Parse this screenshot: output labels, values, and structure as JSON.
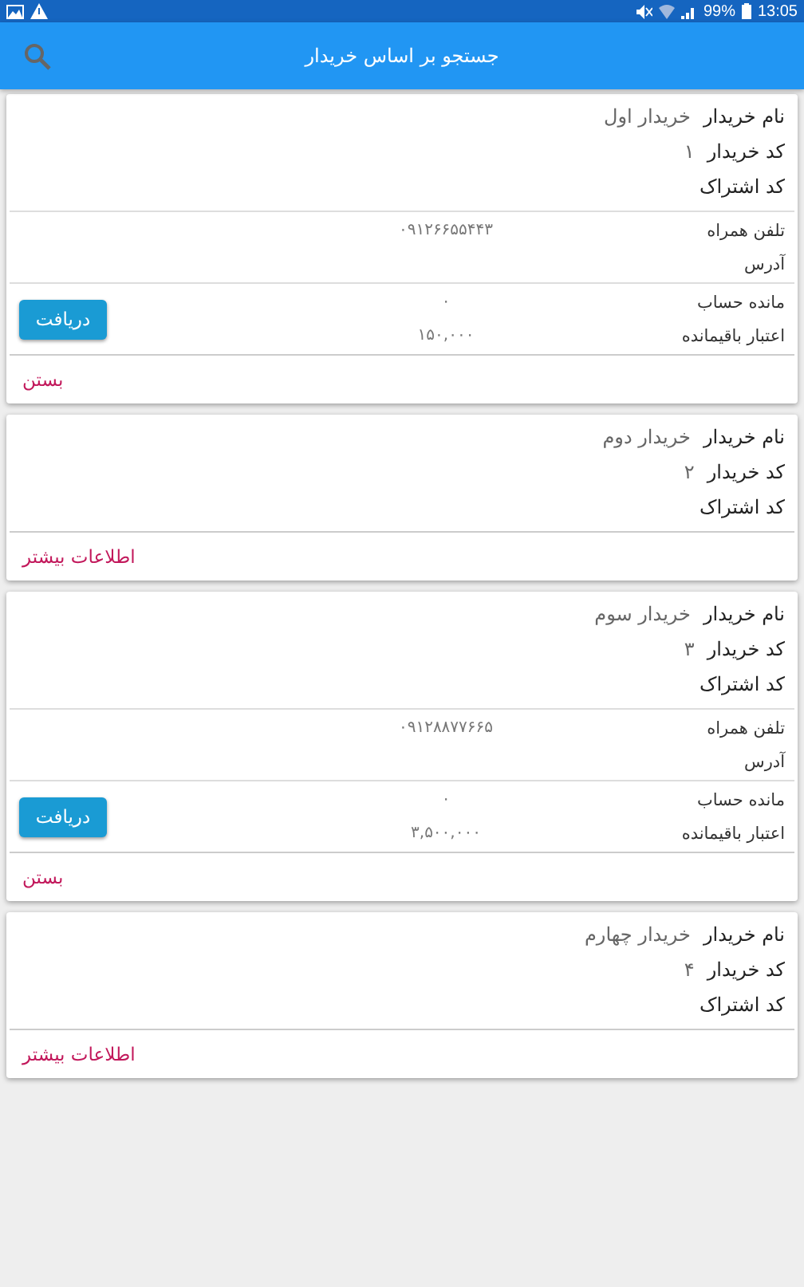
{
  "status_bar": {
    "battery": "99%",
    "time": "13:05"
  },
  "app_bar": {
    "title": "جستجو بر اساس خریدار"
  },
  "cards": [
    {
      "name_label": "نام خریدار",
      "name": "خریدار اول",
      "code_label": "کد خریدار",
      "code": "۱",
      "subscription_label": "کد اشتراک",
      "expanded": true,
      "phone_label": "تلفن همراه",
      "phone": "۰۹۱۲۶۶۵۵۴۴۳",
      "address_label": "آدرس",
      "balance_label": "مانده حساب",
      "balance": "۰",
      "credit_label": "اعتبار باقیمانده",
      "credit": "۱۵۰,۰۰۰",
      "button": "دریافت",
      "footer_link": "بستن"
    },
    {
      "name_label": "نام خریدار",
      "name": "خریدار دوم",
      "code_label": "کد خریدار",
      "code": "۲",
      "subscription_label": "کد اشتراک",
      "expanded": false,
      "footer_link": "اطلاعات بیشتر"
    },
    {
      "name_label": "نام خریدار",
      "name": "خریدار سوم",
      "code_label": "کد خریدار",
      "code": "۳",
      "subscription_label": "کد اشتراک",
      "expanded": true,
      "phone_label": "تلفن همراه",
      "phone": "۰۹۱۲۸۸۷۷۶۶۵",
      "address_label": "آدرس",
      "balance_label": "مانده حساب",
      "balance": "۰",
      "credit_label": "اعتبار باقیمانده",
      "credit": "۳,۵۰۰,۰۰۰",
      "button": "دریافت",
      "footer_link": "بستن"
    },
    {
      "name_label": "نام خریدار",
      "name": "خریدار چهارم",
      "code_label": "کد خریدار",
      "code": "۴",
      "subscription_label": "کد اشتراک",
      "expanded": false,
      "footer_link": "اطلاعات بیشتر"
    }
  ]
}
